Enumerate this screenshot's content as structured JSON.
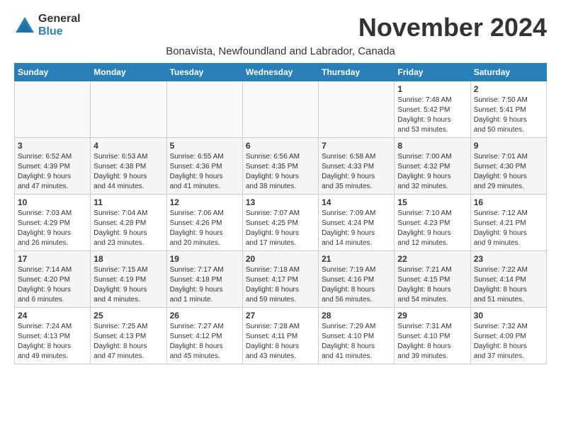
{
  "app": {
    "logo_general": "General",
    "logo_blue": "Blue"
  },
  "header": {
    "month_title": "November 2024",
    "location": "Bonavista, Newfoundland and Labrador, Canada"
  },
  "calendar": {
    "days_of_week": [
      "Sunday",
      "Monday",
      "Tuesday",
      "Wednesday",
      "Thursday",
      "Friday",
      "Saturday"
    ],
    "weeks": [
      [
        {
          "day": "",
          "info": ""
        },
        {
          "day": "",
          "info": ""
        },
        {
          "day": "",
          "info": ""
        },
        {
          "day": "",
          "info": ""
        },
        {
          "day": "",
          "info": ""
        },
        {
          "day": "1",
          "info": "Sunrise: 7:48 AM\nSunset: 5:42 PM\nDaylight: 9 hours\nand 53 minutes."
        },
        {
          "day": "2",
          "info": "Sunrise: 7:50 AM\nSunset: 5:41 PM\nDaylight: 9 hours\nand 50 minutes."
        }
      ],
      [
        {
          "day": "3",
          "info": "Sunrise: 6:52 AM\nSunset: 4:39 PM\nDaylight: 9 hours\nand 47 minutes."
        },
        {
          "day": "4",
          "info": "Sunrise: 6:53 AM\nSunset: 4:38 PM\nDaylight: 9 hours\nand 44 minutes."
        },
        {
          "day": "5",
          "info": "Sunrise: 6:55 AM\nSunset: 4:36 PM\nDaylight: 9 hours\nand 41 minutes."
        },
        {
          "day": "6",
          "info": "Sunrise: 6:56 AM\nSunset: 4:35 PM\nDaylight: 9 hours\nand 38 minutes."
        },
        {
          "day": "7",
          "info": "Sunrise: 6:58 AM\nSunset: 4:33 PM\nDaylight: 9 hours\nand 35 minutes."
        },
        {
          "day": "8",
          "info": "Sunrise: 7:00 AM\nSunset: 4:32 PM\nDaylight: 9 hours\nand 32 minutes."
        },
        {
          "day": "9",
          "info": "Sunrise: 7:01 AM\nSunset: 4:30 PM\nDaylight: 9 hours\nand 29 minutes."
        }
      ],
      [
        {
          "day": "10",
          "info": "Sunrise: 7:03 AM\nSunset: 4:29 PM\nDaylight: 9 hours\nand 26 minutes."
        },
        {
          "day": "11",
          "info": "Sunrise: 7:04 AM\nSunset: 4:28 PM\nDaylight: 9 hours\nand 23 minutes."
        },
        {
          "day": "12",
          "info": "Sunrise: 7:06 AM\nSunset: 4:26 PM\nDaylight: 9 hours\nand 20 minutes."
        },
        {
          "day": "13",
          "info": "Sunrise: 7:07 AM\nSunset: 4:25 PM\nDaylight: 9 hours\nand 17 minutes."
        },
        {
          "day": "14",
          "info": "Sunrise: 7:09 AM\nSunset: 4:24 PM\nDaylight: 9 hours\nand 14 minutes."
        },
        {
          "day": "15",
          "info": "Sunrise: 7:10 AM\nSunset: 4:23 PM\nDaylight: 9 hours\nand 12 minutes."
        },
        {
          "day": "16",
          "info": "Sunrise: 7:12 AM\nSunset: 4:21 PM\nDaylight: 9 hours\nand 9 minutes."
        }
      ],
      [
        {
          "day": "17",
          "info": "Sunrise: 7:14 AM\nSunset: 4:20 PM\nDaylight: 9 hours\nand 6 minutes."
        },
        {
          "day": "18",
          "info": "Sunrise: 7:15 AM\nSunset: 4:19 PM\nDaylight: 9 hours\nand 4 minutes."
        },
        {
          "day": "19",
          "info": "Sunrise: 7:17 AM\nSunset: 4:18 PM\nDaylight: 9 hours\nand 1 minute."
        },
        {
          "day": "20",
          "info": "Sunrise: 7:18 AM\nSunset: 4:17 PM\nDaylight: 8 hours\nand 59 minutes."
        },
        {
          "day": "21",
          "info": "Sunrise: 7:19 AM\nSunset: 4:16 PM\nDaylight: 8 hours\nand 56 minutes."
        },
        {
          "day": "22",
          "info": "Sunrise: 7:21 AM\nSunset: 4:15 PM\nDaylight: 8 hours\nand 54 minutes."
        },
        {
          "day": "23",
          "info": "Sunrise: 7:22 AM\nSunset: 4:14 PM\nDaylight: 8 hours\nand 51 minutes."
        }
      ],
      [
        {
          "day": "24",
          "info": "Sunrise: 7:24 AM\nSunset: 4:13 PM\nDaylight: 8 hours\nand 49 minutes."
        },
        {
          "day": "25",
          "info": "Sunrise: 7:25 AM\nSunset: 4:13 PM\nDaylight: 8 hours\nand 47 minutes."
        },
        {
          "day": "26",
          "info": "Sunrise: 7:27 AM\nSunset: 4:12 PM\nDaylight: 8 hours\nand 45 minutes."
        },
        {
          "day": "27",
          "info": "Sunrise: 7:28 AM\nSunset: 4:11 PM\nDaylight: 8 hours\nand 43 minutes."
        },
        {
          "day": "28",
          "info": "Sunrise: 7:29 AM\nSunset: 4:10 PM\nDaylight: 8 hours\nand 41 minutes."
        },
        {
          "day": "29",
          "info": "Sunrise: 7:31 AM\nSunset: 4:10 PM\nDaylight: 8 hours\nand 39 minutes."
        },
        {
          "day": "30",
          "info": "Sunrise: 7:32 AM\nSunset: 4:09 PM\nDaylight: 8 hours\nand 37 minutes."
        }
      ]
    ]
  }
}
